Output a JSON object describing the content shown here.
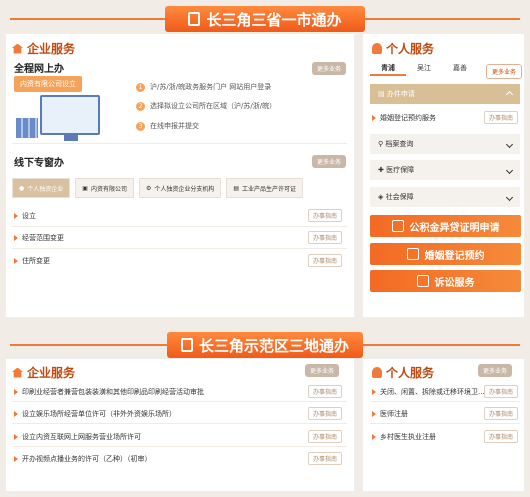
{
  "top_banner": {
    "title": "长三角三省一市通办"
  },
  "bottom_banner": {
    "title": "长三角示范区三地通办"
  },
  "enterprise": {
    "title": "企业服务",
    "more": "更多业务",
    "online": {
      "title": "全程网上办",
      "chip": "内资有限公司设立",
      "steps": [
        {
          "num": "1",
          "text": "沪/苏/浙/皖政务服务门户 网站用户登录"
        },
        {
          "num": "2",
          "text": "选择拟设立公司所在区域（沪/苏/浙/皖）"
        },
        {
          "num": "3",
          "text": "在线申报并提交"
        }
      ]
    },
    "offline": {
      "title": "线下专窗办",
      "more": "更多业务",
      "tabs": [
        "个人独资企业",
        "内资有限公司",
        "个人独资企业分支机构",
        "工业产品生产许可证"
      ],
      "rows": [
        "设立",
        "经营范围变更",
        "住所变更"
      ],
      "handle": "办事指南"
    }
  },
  "personal": {
    "title": "个人服务",
    "more": "更多业务",
    "cities": [
      "青浦",
      "吴江",
      "嘉善"
    ],
    "accordion_open": "办件申请",
    "open_item": "婚姻登记预约服务",
    "handle": "办事指南",
    "accordion_closed": [
      "档案查询",
      "医疗保障",
      "社会保障"
    ],
    "big_buttons": [
      "公积金异贷证明申请",
      "婚姻登记预约",
      "诉讼服务"
    ]
  },
  "bottom_enterprise": {
    "title": "企业服务",
    "more": "更多业务",
    "rows": [
      "印刷业经营者兼营包装装潢和其他印刷品印刷经营活动审批",
      "设立娱乐场所经营单位许可（非外外资娱乐场所）",
      "设立内资互联网上网服务营业场所许可",
      "开办视频点播业务的许可（乙种）（初审）"
    ],
    "handle": "办事指南"
  },
  "bottom_personal": {
    "title": "个人服务",
    "more": "更多业务",
    "rows": [
      "关闭、闲置、拆除或迁移环境卫...",
      "医师注册",
      "乡村医生执业注册"
    ],
    "handle": "办事指南"
  }
}
